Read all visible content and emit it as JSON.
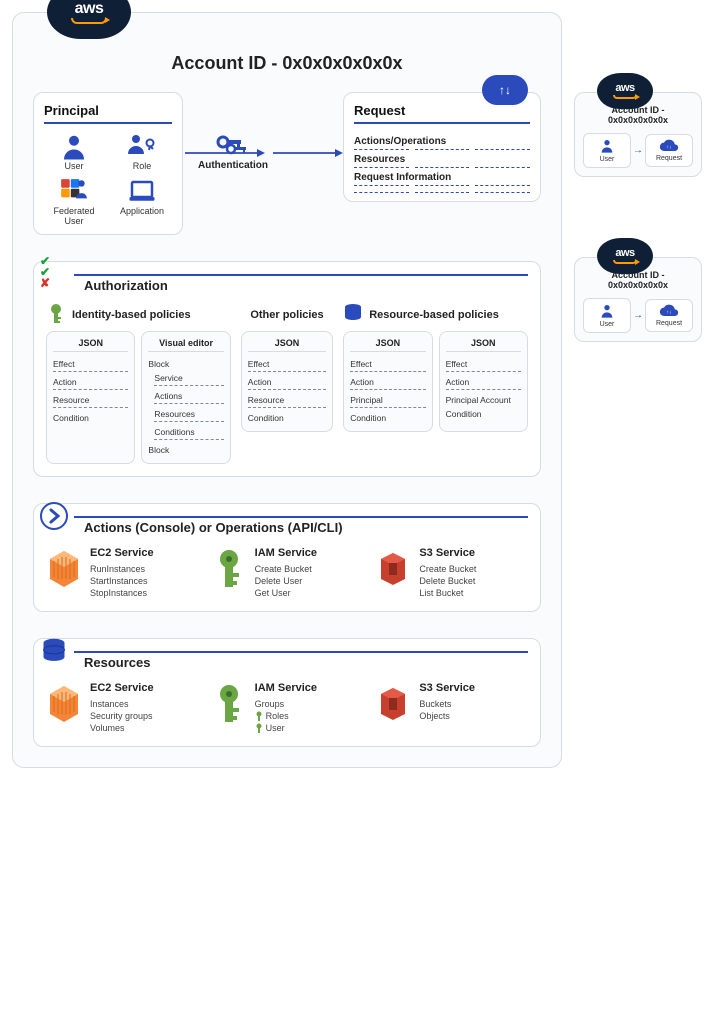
{
  "accountId": "Account ID - 0x0x0x0x0x0x",
  "principal": {
    "title": "Principal",
    "items": [
      "User",
      "Role",
      "Federated User",
      "Application"
    ]
  },
  "auth": "Authentication",
  "request": {
    "title": "Request",
    "items": [
      "Actions/Operations",
      "Resources",
      "Request Information"
    ]
  },
  "authorization": {
    "title": "Authorization",
    "groups": [
      {
        "title": "Identity-based policies",
        "boxes": [
          {
            "title": "JSON",
            "fields": [
              "Effect",
              "Action",
              "Resource",
              "Condition"
            ]
          },
          {
            "title": "Visual editor",
            "fields": [
              "Block",
              "Service",
              "Actions",
              "Resources",
              "Conditions",
              "Block"
            ]
          }
        ]
      },
      {
        "title": "Other policies",
        "boxes": [
          {
            "title": "JSON",
            "fields": [
              "Effect",
              "Action",
              "Resource",
              "Condition"
            ]
          }
        ]
      },
      {
        "title": "Resource-based policies",
        "boxes": [
          {
            "title": "JSON",
            "fields": [
              "Effect",
              "Action",
              "Principal",
              "Condition"
            ]
          },
          {
            "title": "JSON",
            "fields": [
              "Effect",
              "Action",
              "Principal Account",
              "Condition"
            ]
          }
        ]
      }
    ]
  },
  "actions": {
    "title": "Actions (Console) or Operations (API/CLI)",
    "services": [
      {
        "name": "EC2 Service",
        "items": [
          "RunInstances",
          "StartInstances",
          "StopInstances"
        ]
      },
      {
        "name": "IAM Service",
        "items": [
          "Create Bucket",
          "Delete User",
          "Get User"
        ]
      },
      {
        "name": "S3 Service",
        "items": [
          "Create Bucket",
          "Delete Bucket",
          "List Bucket"
        ]
      }
    ]
  },
  "resources": {
    "title": "Resources",
    "services": [
      {
        "name": "EC2 Service",
        "items": [
          "Instances",
          "Security groups",
          "Volumes"
        ]
      },
      {
        "name": "IAM Service",
        "items": [
          "Groups",
          "Roles",
          "User"
        ],
        "icons": [
          "",
          "key",
          "key"
        ]
      },
      {
        "name": "S3 Service",
        "items": [
          "Buckets",
          "Objects"
        ]
      }
    ]
  },
  "side": {
    "accountId": "Account ID - 0x0x0x0x0x0x",
    "user": "User",
    "request": "Request"
  }
}
